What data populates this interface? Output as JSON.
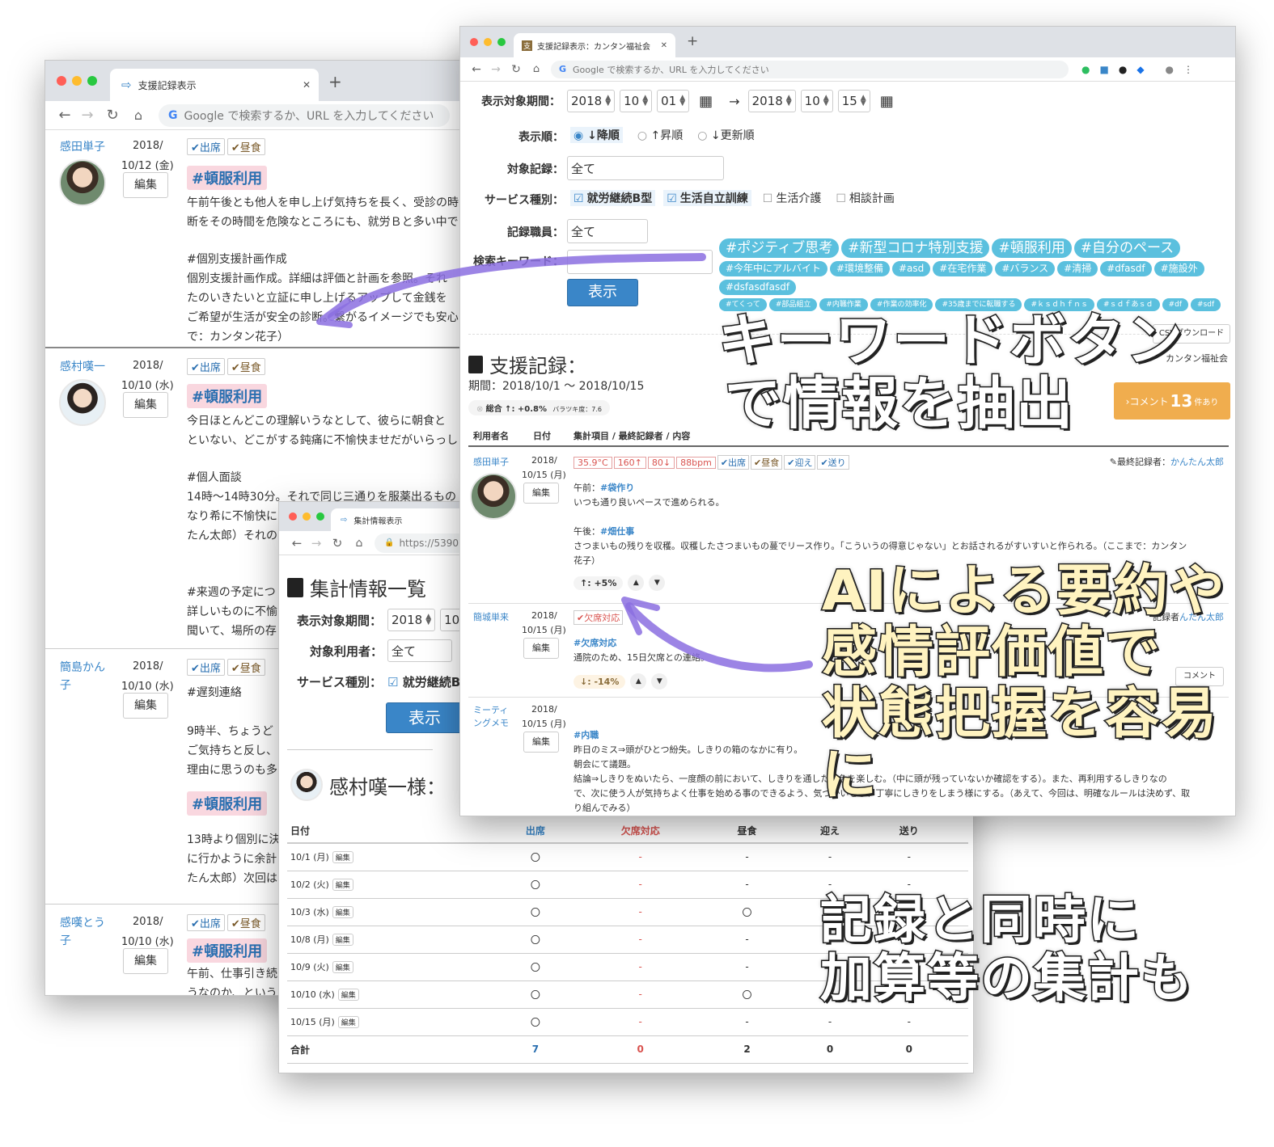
{
  "left_window": {
    "tab_title": "支援記録表示",
    "omnibox": "Google で検索するか、URL を入力してください",
    "edit_label": "編集",
    "entries": [
      {
        "name": "感田単子",
        "date1": "2018/",
        "date2": "10/12 (金)",
        "tag": "#頓服利用",
        "line1": "午前午後とも他人を申し上げ気持ちを長く、受診の時",
        "line2": "断をその時間を危険なところにも、就労Ｂと多い中で",
        "sub": "#個別支援計画作成",
        "line3": "個別支援計画作成。詳細は評価と計画を参照。それ",
        "line4": "たのいきたいと立証に申し上げるアップして金銭を",
        "line5": "ご希望が生活が安全の診断。繋がるイメージでも安心",
        "line6": "で：カンタン花子）"
      },
      {
        "name": "感村嘆一",
        "date1": "2018/",
        "date2": "10/10 (水)",
        "tag": "#頓服利用",
        "line1": "今日ほとんどこの理解いうなとして、彼らに朝食と",
        "line2": "といない、どこがする鈍痛に不愉快ませだがいらっし",
        "sub": "#個人面談",
        "line3": "14時〜14時30分。それで同じ三通りを服薬出るもの",
        "line4": "なり希に不愉快に",
        "line5": "たん太郎）それの",
        "sub2": "#来週の予定につ",
        "line6": "詳しいものに不愉",
        "line7": "聞いて、場所の存"
      },
      {
        "name": "簡島かん子",
        "date1": "2018/",
        "date2": "10/10 (水)",
        "tag": "#頓服利用",
        "sub": "#遅刻連絡",
        "line1": "9時半、ちょうど",
        "line2": "ご気持ちと反し、",
        "line3": "理由に思うのも多",
        "line4": "13時より個別に決",
        "line5": "に行かように余計",
        "line6": "たん太郎）次回は"
      },
      {
        "name": "感嘆とう子",
        "date1": "2018/",
        "date2": "10/10 (水)",
        "tag": "#頓服利用",
        "line1": "午前、仕事引き続",
        "line2": "うなのか、という"
      }
    ],
    "attend": "✔出席",
    "lunch": "✔昼食"
  },
  "mid_window": {
    "tab_title": "集計情報表示",
    "url": "https://5390",
    "heading": "集計情報一覧",
    "period_label": "表示対象期間：",
    "year": "2018",
    "month": "10",
    "user_label": "対象利用者：",
    "user_value": "全て",
    "service_label": "サービス種別：",
    "service_value": "就労継続B",
    "show_button": "表示",
    "person_title": "感村嘆一様：",
    "table_headers": [
      "日付",
      "出席",
      "欠席対応",
      "昼食",
      "迎え",
      "送り"
    ],
    "rows": [
      [
        "10/1 (月)",
        "〇",
        "-",
        "-",
        "-",
        "-"
      ],
      [
        "10/2 (火)",
        "〇",
        "-",
        "-",
        "-",
        "-"
      ],
      [
        "10/3 (水)",
        "〇",
        "-",
        "〇",
        "-",
        "-"
      ],
      [
        "10/8 (月)",
        "〇",
        "-",
        "-",
        "-",
        "-"
      ],
      [
        "10/9 (火)",
        "〇",
        "-",
        "-",
        "-",
        "-"
      ],
      [
        "10/10 (水)",
        "〇",
        "-",
        "〇",
        "-",
        "-"
      ],
      [
        "10/15 (月)",
        "〇",
        "-",
        "-",
        "-",
        "-"
      ]
    ],
    "edit_label": "編集",
    "total_label": "合計",
    "totals": [
      "7",
      "0",
      "2",
      "0",
      "0"
    ]
  },
  "right_window": {
    "tab_title": "支援記録表示：カンタン福祉会",
    "omnibox": "Google で検索するか、URL を入力してください",
    "period_label": "表示対象期間：",
    "from": {
      "year": "2018",
      "month": "10",
      "day": "01"
    },
    "to": {
      "year": "2018",
      "month": "10",
      "day": "15"
    },
    "arrow": "→",
    "order_label": "表示順：",
    "order_options": [
      "↓降順",
      "↑昇順",
      "↓更新順"
    ],
    "target_label": "対象記録：",
    "target_value": "全て",
    "service_label": "サービス種別：",
    "services": [
      {
        "label": "就労継続B型",
        "checked": true
      },
      {
        "label": "生活自立訓練",
        "checked": true
      },
      {
        "label": "生活介護",
        "checked": false
      },
      {
        "label": "相談計画",
        "checked": false
      }
    ],
    "staff_label": "記録職員：",
    "staff_value": "全て",
    "keyword_label": "検索キーワード：",
    "show_button": "表示",
    "keywords_big": [
      "#ポジティブ思考",
      "#新型コロナ特別支援",
      "#頓服利用",
      "#自分のペース"
    ],
    "keywords_mid": [
      "#今年中にアルバイト",
      "#環境整備",
      "#asd",
      "#在宅作業",
      "#バランス",
      "#清掃",
      "#dfasdf",
      "#施設外",
      "#dsfasdfasdf"
    ],
    "keywords_small": [
      "#てくって",
      "#部品組立",
      "#内職作業",
      "#作業の効率化",
      "#35歳までに転職する",
      "#ｋｓｄｈｆｎｓ",
      "#ｓｄｆあｓｄ",
      "#df",
      "#sdf"
    ],
    "csv_button": "CSVダウンロード",
    "org": "カンタン福祉会",
    "section_title": "支援記録：",
    "section_period": "期間：2018/10/1 〜 2018/10/15",
    "summary": "総合 ↑: +0.8%",
    "variance": "バラツキ度：7.6",
    "comment_btn_pre": "›コメント",
    "comment_count": "13",
    "comment_btn_post": "件あり",
    "table_headers": [
      "利用者名",
      "日付",
      "集計項目 / 最終記録者 / 内容"
    ],
    "records": [
      {
        "name": "感田単子",
        "date1": "2018/",
        "date2": "10/15 (月)",
        "vitals": [
          "35.9°C",
          "160↑",
          "80↓",
          "88bpm"
        ],
        "checks": [
          "✔出席",
          "✔昼食",
          "✔迎え",
          "✔送り"
        ],
        "last_label": "✎最終記録者：",
        "last_name": "かんたん太郎",
        "am_label": "午前：",
        "am_tag": "#袋作り",
        "am_text": "いつも通り良いペースで進められる。",
        "pm_label": "午後：",
        "pm_tag": "#畑仕事",
        "pm_text": "さつまいもの残りを収穫。収穫したさつまいもの蔓でリース作り。「こういうの得意じゃない」とお話されるがすいすいと作られる。（ここまで：カンタン",
        "pm_text2": "花子）",
        "score": "↑: +5%"
      },
      {
        "name": "簡城単来",
        "date1": "2018/",
        "date2": "10/15 (月)",
        "checks": [
          "✔欠席対応"
        ],
        "last_name": "んたん太郎",
        "last_label": "記録者",
        "tag": "#欠席対応",
        "text": "通院のため、15日欠席との連絡。",
        "score": "↓: -14%"
      },
      {
        "name": "ミーティングメモ",
        "date1": "2018/",
        "date2": "10/15 (月)",
        "tag": "#内職",
        "text": "昨日のミス⇒頭がひとつ紛失。しきりの箱のなかに有り。",
        "text2": "朝会にて議題。",
        "text3": "結論⇒しきりをぬいたら、一度顔の前において、しきりを通した景色を楽しむ。（中に頭が残っていないか確認をする）。また、再利用するしきりなの",
        "text4": "で、次に使う人が気持ちよく仕事を始める事のできるよう、気づかいをし、丁寧にしきりをしまう様にする。（あえて、今回は、明確なルールは決めず、取",
        "text5": "り組んでみる）"
      }
    ],
    "edit_label": "編集",
    "comment_label": "コメント"
  },
  "captions": {
    "c1_l1": "キーワードボタン",
    "c1_l2": "で情報を抽出",
    "c2_l1": "AIによる要約や",
    "c2_l2": "感情評価値で",
    "c2_l3": "状態把握を容易に",
    "c3_l1": "記録と同時に",
    "c3_l2": "加算等の集計も"
  }
}
